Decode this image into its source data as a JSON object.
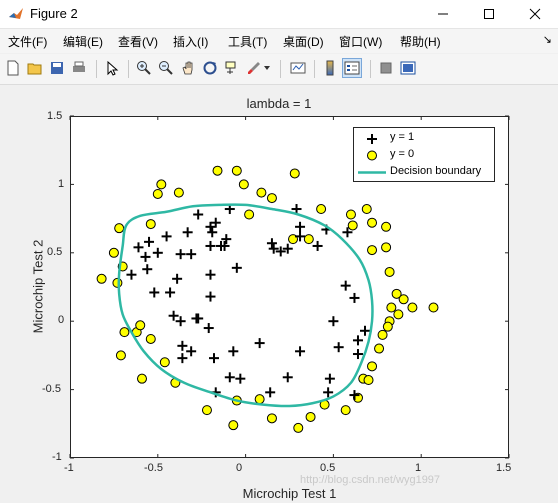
{
  "window": {
    "title": "Figure 2",
    "controls": [
      "minimize",
      "maximize",
      "close"
    ]
  },
  "menu": {
    "items": [
      "文件(F)",
      "编辑(E)",
      "查看(V)",
      "插入(I)",
      "工具(T)",
      "桌面(D)",
      "窗口(W)",
      "帮助(H)"
    ],
    "overflow": "↘"
  },
  "toolbar": {
    "icons": [
      "new-figure-icon",
      "open-file-icon",
      "save-icon",
      "print-icon",
      "edit-plot-icon",
      "zoom-in-icon",
      "zoom-out-icon",
      "pan-icon",
      "rotate-3d-icon",
      "data-cursor-icon",
      "brush-icon",
      "link-plot-icon",
      "colorbar-icon",
      "legend-icon",
      "hide-plot-tools-icon",
      "show-plot-tools-icon"
    ]
  },
  "watermark": "http://blog.csdn.net/wyg1997",
  "chart_data": {
    "type": "scatter",
    "title": "lambda = 1",
    "xlabel": "Microchip Test 1",
    "ylabel": "Microchip Test 2",
    "xlim": [
      -1,
      1.5
    ],
    "ylim": [
      -1,
      1.5
    ],
    "xticks": [
      -1,
      -0.5,
      0,
      0.5,
      1,
      1.5
    ],
    "yticks": [
      -1,
      -0.5,
      0,
      0.5,
      1,
      1.5
    ],
    "xtick_labels": [
      "-1",
      "-0.5",
      "0",
      "0.5",
      "1",
      "1.5"
    ],
    "ytick_labels": [
      "-1",
      "-0.5",
      "0",
      "0.5",
      "1",
      "1.5"
    ],
    "grid": false,
    "legend": {
      "placement": "top-right",
      "entries": [
        "y = 1",
        "y = 0",
        "Decision boundary"
      ]
    },
    "colors": {
      "pos": "#000000",
      "neg_fill": "#ffff00",
      "neg_edge": "#000000",
      "boundary": "#2fb8a4"
    },
    "series": [
      {
        "name": "y = 1",
        "marker": "plus",
        "points": [
          [
            -0.09,
            0.82
          ],
          [
            -0.27,
            0.78
          ],
          [
            -0.17,
            0.72
          ],
          [
            -0.2,
            0.69
          ],
          [
            -0.33,
            0.65
          ],
          [
            -0.45,
            0.62
          ],
          [
            -0.55,
            0.58
          ],
          [
            -0.61,
            0.54
          ],
          [
            -0.57,
            0.47
          ],
          [
            -0.5,
            0.5
          ],
          [
            -0.37,
            0.49
          ],
          [
            -0.31,
            0.49
          ],
          [
            -0.19,
            0.65
          ],
          [
            -0.2,
            0.55
          ],
          [
            -0.14,
            0.55
          ],
          [
            -0.12,
            0.55
          ],
          [
            -0.11,
            0.6
          ],
          [
            0.15,
            0.57
          ],
          [
            0.16,
            0.53
          ],
          [
            0.2,
            0.51
          ],
          [
            0.24,
            0.53
          ],
          [
            0.31,
            0.69
          ],
          [
            0.31,
            0.62
          ],
          [
            0.41,
            0.55
          ],
          [
            0.46,
            0.67
          ],
          [
            -0.39,
            0.31
          ],
          [
            -0.56,
            0.38
          ],
          [
            -0.65,
            0.34
          ],
          [
            -0.52,
            0.21
          ],
          [
            -0.43,
            0.21
          ],
          [
            -0.2,
            0.34
          ],
          [
            -0.2,
            0.18
          ],
          [
            -0.05,
            0.39
          ],
          [
            -0.28,
            0.02
          ],
          [
            -0.41,
            0.04
          ],
          [
            -0.37,
            0.0
          ],
          [
            -0.27,
            0.02
          ],
          [
            -0.21,
            -0.05
          ],
          [
            -0.36,
            -0.18
          ],
          [
            -0.31,
            -0.22
          ],
          [
            -0.18,
            -0.27
          ],
          [
            -0.07,
            -0.22
          ],
          [
            -0.09,
            -0.41
          ],
          [
            -0.03,
            -0.42
          ],
          [
            0.08,
            -0.16
          ],
          [
            0.14,
            -0.52
          ],
          [
            0.24,
            -0.41
          ],
          [
            0.31,
            -0.22
          ],
          [
            0.48,
            -0.42
          ],
          [
            0.47,
            -0.52
          ],
          [
            0.5,
            0.0
          ],
          [
            0.53,
            -0.19
          ],
          [
            0.57,
            0.26
          ],
          [
            0.62,
            0.17
          ],
          [
            0.64,
            -0.14
          ],
          [
            0.64,
            -0.24
          ],
          [
            0.68,
            -0.07
          ],
          [
            0.62,
            -0.54
          ],
          [
            -0.36,
            -0.27
          ],
          [
            -0.17,
            -0.52
          ],
          [
            0.58,
            0.65
          ],
          [
            0.29,
            0.82
          ]
        ]
      },
      {
        "name": "y = 0",
        "marker": "circle",
        "points": [
          [
            -0.05,
            1.1
          ],
          [
            -0.01,
            1.0
          ],
          [
            0.09,
            0.94
          ],
          [
            0.28,
            1.08
          ],
          [
            0.27,
            0.6
          ],
          [
            0.43,
            0.82
          ],
          [
            0.6,
            0.78
          ],
          [
            0.61,
            0.7
          ],
          [
            0.72,
            0.72
          ],
          [
            0.8,
            0.69
          ],
          [
            0.8,
            0.54
          ],
          [
            0.82,
            0.36
          ],
          [
            0.86,
            0.2
          ],
          [
            0.95,
            0.1
          ],
          [
            0.87,
            0.05
          ],
          [
            0.82,
            0.0
          ],
          [
            0.81,
            -0.04
          ],
          [
            0.78,
            -0.1
          ],
          [
            0.76,
            -0.2
          ],
          [
            0.72,
            -0.33
          ],
          [
            0.67,
            -0.42
          ],
          [
            0.64,
            -0.56
          ],
          [
            0.57,
            -0.65
          ],
          [
            0.45,
            -0.61
          ],
          [
            0.37,
            -0.7
          ],
          [
            0.3,
            -0.78
          ],
          [
            0.15,
            -0.71
          ],
          [
            0.08,
            -0.57
          ],
          [
            -0.05,
            -0.58
          ],
          [
            -0.07,
            -0.76
          ],
          [
            -0.22,
            -0.65
          ],
          [
            -0.4,
            -0.45
          ],
          [
            -0.46,
            -0.3
          ],
          [
            -0.59,
            -0.42
          ],
          [
            -0.71,
            -0.25
          ],
          [
            -0.69,
            -0.08
          ],
          [
            -0.62,
            -0.08
          ],
          [
            -0.6,
            -0.03
          ],
          [
            -0.54,
            -0.13
          ],
          [
            -0.75,
            0.5
          ],
          [
            -0.72,
            0.68
          ],
          [
            -0.7,
            0.4
          ],
          [
            -0.82,
            0.31
          ],
          [
            -0.73,
            0.28
          ],
          [
            -0.54,
            0.71
          ],
          [
            -0.5,
            0.93
          ],
          [
            -0.48,
            1.0
          ],
          [
            -0.38,
            0.94
          ],
          [
            -0.16,
            1.1
          ],
          [
            0.02,
            0.78
          ],
          [
            0.15,
            0.9
          ],
          [
            0.72,
            0.52
          ],
          [
            0.69,
            0.82
          ],
          [
            0.7,
            -0.43
          ],
          [
            0.36,
            0.6
          ],
          [
            0.9,
            0.16
          ],
          [
            1.07,
            0.1
          ],
          [
            0.83,
            0.1
          ]
        ]
      }
    ],
    "decision_boundary": [
      [
        -0.7,
        0.55
      ],
      [
        -0.68,
        0.7
      ],
      [
        -0.6,
        0.77
      ],
      [
        -0.45,
        0.8
      ],
      [
        -0.3,
        0.84
      ],
      [
        -0.15,
        0.85
      ],
      [
        0.0,
        0.85
      ],
      [
        0.15,
        0.82
      ],
      [
        0.3,
        0.78
      ],
      [
        0.45,
        0.7
      ],
      [
        0.55,
        0.6
      ],
      [
        0.65,
        0.45
      ],
      [
        0.7,
        0.3
      ],
      [
        0.72,
        0.15
      ],
      [
        0.72,
        0.0
      ],
      [
        0.7,
        -0.15
      ],
      [
        0.66,
        -0.3
      ],
      [
        0.6,
        -0.45
      ],
      [
        0.5,
        -0.55
      ],
      [
        0.38,
        -0.6
      ],
      [
        0.25,
        -0.62
      ],
      [
        0.1,
        -0.61
      ],
      [
        -0.05,
        -0.58
      ],
      [
        -0.2,
        -0.52
      ],
      [
        -0.35,
        -0.45
      ],
      [
        -0.48,
        -0.35
      ],
      [
        -0.58,
        -0.22
      ],
      [
        -0.65,
        -0.08
      ],
      [
        -0.7,
        0.05
      ],
      [
        -0.72,
        0.2
      ],
      [
        -0.72,
        0.35
      ],
      [
        -0.7,
        0.55
      ]
    ]
  }
}
